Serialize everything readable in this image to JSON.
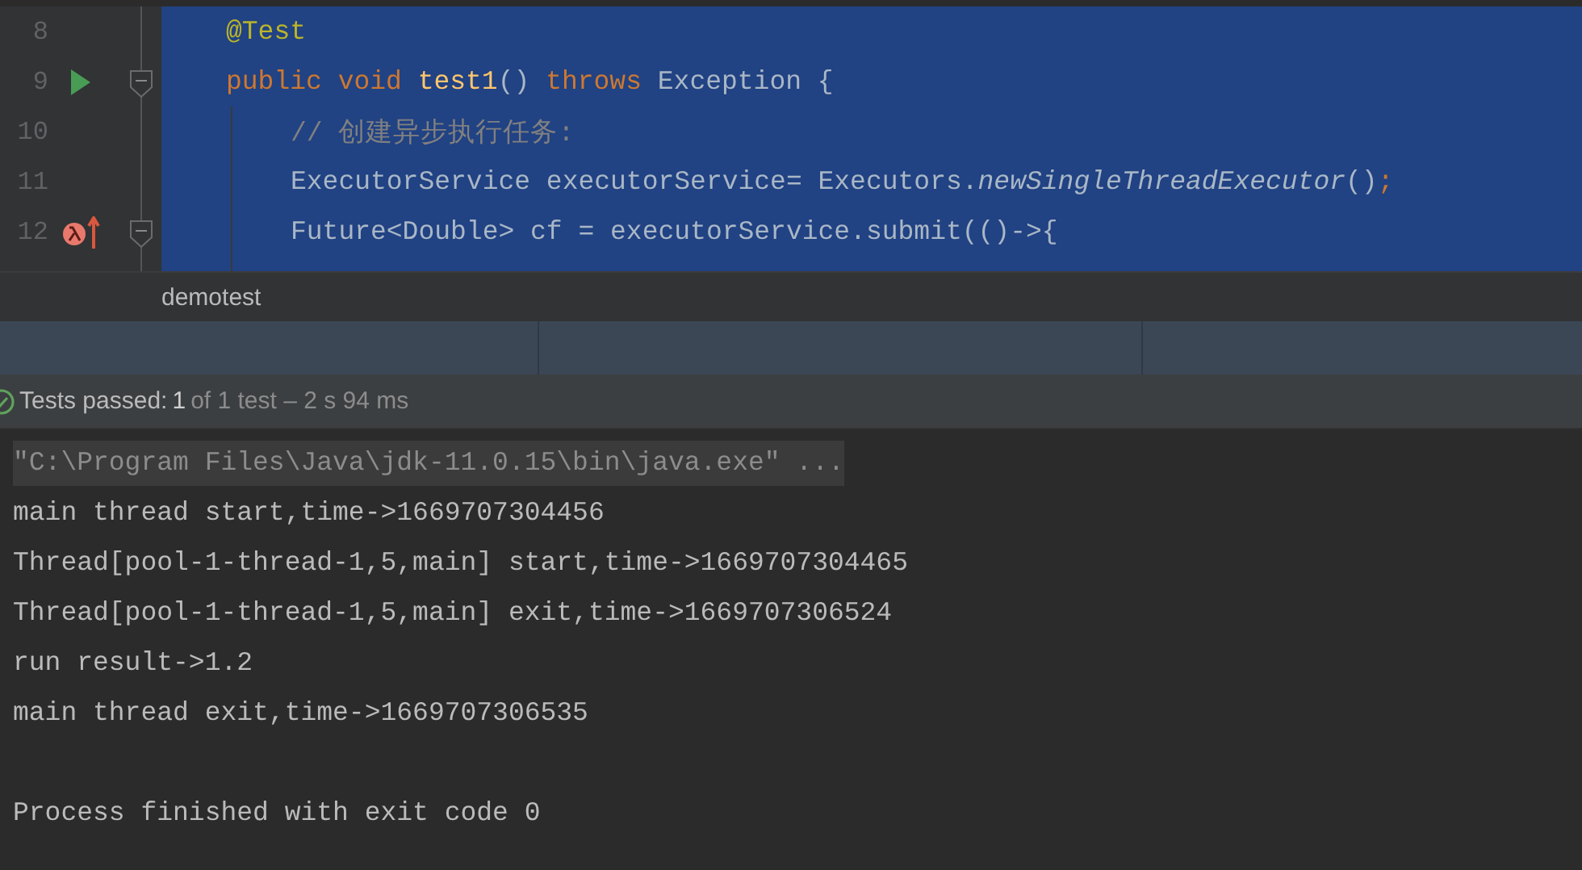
{
  "editor": {
    "lines": [
      {
        "number": "8",
        "run": false,
        "lambda": false,
        "fold": false,
        "tokens": [
          {
            "text": "@Test",
            "kind": "annotation"
          }
        ]
      },
      {
        "number": "9",
        "run": true,
        "lambda": false,
        "fold": true,
        "tokens": [
          {
            "text": "public ",
            "kind": "keyword"
          },
          {
            "text": "void ",
            "kind": "keyword"
          },
          {
            "text": "test1",
            "kind": "method"
          },
          {
            "text": "() ",
            "kind": "plain"
          },
          {
            "text": "throws",
            "kind": "keyword"
          },
          {
            "text": " Exception {",
            "kind": "plain"
          }
        ],
        "children": [
          {
            "number": "10",
            "run": false,
            "lambda": false,
            "fold": false,
            "tokens": [
              {
                "text": "// 创建异步执行任务:",
                "kind": "comment"
              }
            ]
          },
          {
            "number": "11",
            "run": false,
            "lambda": false,
            "fold": false,
            "tokens": [
              {
                "text": "ExecutorService executorService= Executors.",
                "kind": "plain"
              },
              {
                "text": "newSingleThreadExecutor",
                "kind": "static"
              },
              {
                "text": "()",
                "kind": "plain"
              },
              {
                "text": ";",
                "kind": "keyword"
              }
            ]
          },
          {
            "number": "12",
            "run": false,
            "lambda": true,
            "fold": true,
            "tokens": [
              {
                "text": "Future<Double> cf = executorService.submit(()->{",
                "kind": "plain"
              }
            ]
          }
        ]
      }
    ]
  },
  "breadcrumb": "demotest",
  "test_status": {
    "passed": true,
    "label": "Tests passed:",
    "count": "1",
    "detail": "of 1 test – 2 s 94 ms"
  },
  "console": {
    "lines": [
      {
        "text": "\"C:\\Program Files\\Java\\jdk-11.0.15\\bin\\java.exe\" ...",
        "kind": "command"
      },
      {
        "text": "main thread start,time->1669707304456",
        "kind": "output"
      },
      {
        "text": "Thread[pool-1-thread-1,5,main] start,time->1669707304465",
        "kind": "output"
      },
      {
        "text": "Thread[pool-1-thread-1,5,main] exit,time->1669707306524",
        "kind": "output"
      },
      {
        "text": "run result->1.2",
        "kind": "output"
      },
      {
        "text": "main thread exit,time->1669707306535",
        "kind": "output"
      },
      {
        "kind": "blank"
      },
      {
        "text": "Process finished with exit code 0",
        "kind": "output"
      }
    ]
  }
}
